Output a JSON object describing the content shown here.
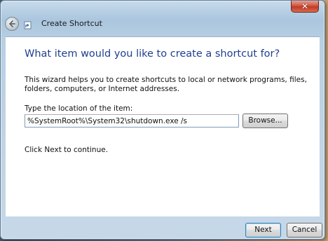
{
  "window": {
    "title": "Create Shortcut",
    "close_label": "✕"
  },
  "wizard": {
    "heading": "What item would you like to create a shortcut for?",
    "description": "This wizard helps you to create shortcuts to local or network programs, files, folders, computers, or Internet addresses.",
    "location_label": "Type the location of the item:",
    "location_value": "%SystemRoot%\\System32\\shutdown.exe /s",
    "browse_label": "Browse...",
    "continue_text": "Click Next to continue."
  },
  "footer": {
    "next_label": "Next",
    "cancel_label": "Cancel"
  },
  "colors": {
    "heading": "#1f3f8f",
    "close_button": "#c13a24"
  }
}
